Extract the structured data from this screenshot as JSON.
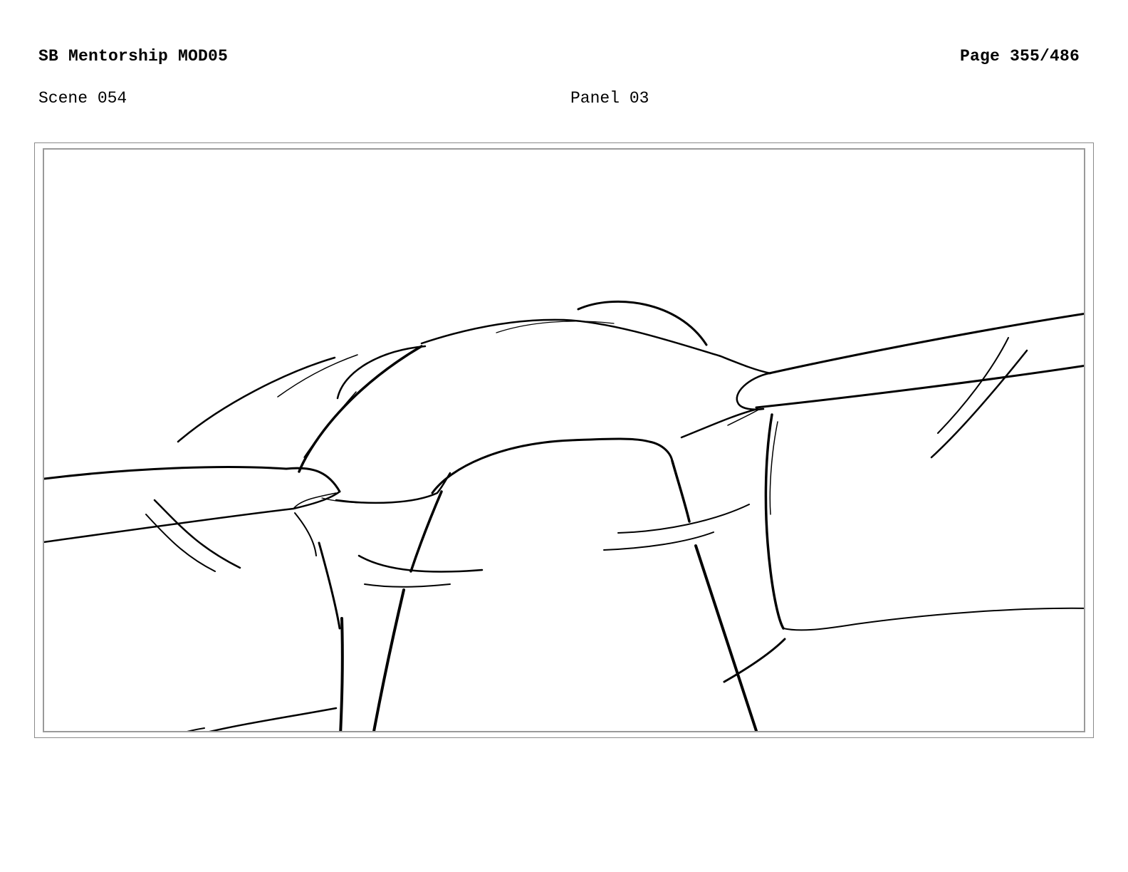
{
  "header": {
    "title": "SB Mentorship MOD05",
    "page": "Page 355/486"
  },
  "panel_info": {
    "scene": "Scene 054",
    "panel": "Panel 03"
  }
}
